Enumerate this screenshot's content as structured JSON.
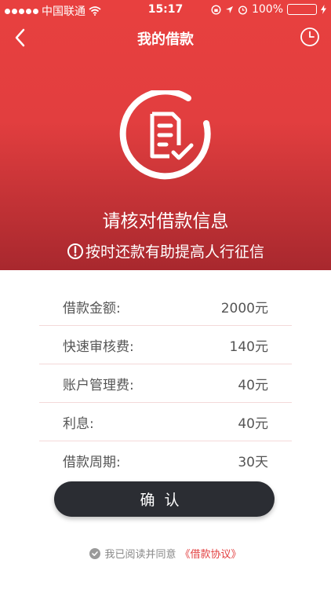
{
  "status_bar": {
    "carrier": "中国联通",
    "time": "15:17",
    "battery": "100%"
  },
  "nav": {
    "title": "我的借款"
  },
  "hero": {
    "title": "请核对借款信息",
    "tip": "按时还款有助提高人行征信"
  },
  "details": [
    {
      "label": "借款金额:",
      "value": "2000元"
    },
    {
      "label": "快速审核费:",
      "value": "140元"
    },
    {
      "label": "账户管理费:",
      "value": "40元"
    },
    {
      "label": "利息:",
      "value": "40元"
    },
    {
      "label": "借款周期:",
      "value": "30天"
    }
  ],
  "confirm_button": "确认",
  "agreement": {
    "text": "我已阅读并同意",
    "link": "《借款协议》"
  },
  "colors": {
    "primary": "#e23e3f",
    "button": "#2b2d33",
    "battery": "#4cd964"
  }
}
